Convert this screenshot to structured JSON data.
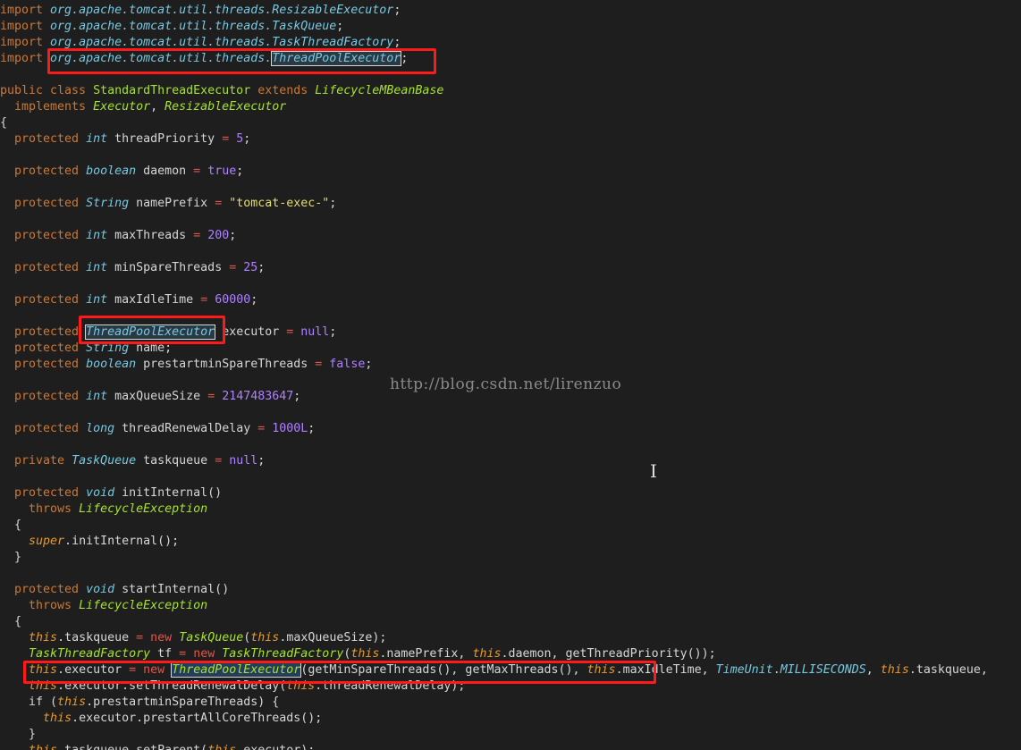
{
  "code": {
    "lines": [
      {
        "tokens": [
          {
            "t": "import ",
            "c": "kw"
          },
          {
            "t": "org.apache.tomcat.util.threads.ResizableExecutor",
            "c": "pk"
          },
          {
            "t": ";"
          }
        ]
      },
      {
        "tokens": [
          {
            "t": "import ",
            "c": "kw"
          },
          {
            "t": "org.apache.tomcat.util.threads.TaskQueue",
            "c": "pk"
          },
          {
            "t": ";"
          }
        ]
      },
      {
        "tokens": [
          {
            "t": "import ",
            "c": "kw"
          },
          {
            "t": "org.apache.tomcat.util.threads.TaskThreadFactory",
            "c": "pk"
          },
          {
            "t": ";"
          }
        ]
      },
      {
        "tokens": [
          {
            "t": "import ",
            "c": "kw"
          },
          {
            "t": "org.apache.tomcat.util.threads.",
            "c": "pk"
          },
          {
            "t": "ThreadPoolExecutor",
            "c": "pk hl"
          },
          {
            "t": ";"
          }
        ]
      },
      {
        "tokens": []
      },
      {
        "tokens": [
          {
            "t": "public class ",
            "c": "kw"
          },
          {
            "t": "StandardThreadExecutor",
            "c": "cls"
          },
          {
            "t": " extends ",
            "c": "kw"
          },
          {
            "t": "LifecycleMBeanBase",
            "c": "sup"
          }
        ]
      },
      {
        "tokens": [
          {
            "t": "  implements ",
            "c": "kw"
          },
          {
            "t": "Executor",
            "c": "sup"
          },
          {
            "t": ", "
          },
          {
            "t": "ResizableExecutor",
            "c": "sup"
          }
        ]
      },
      {
        "tokens": [
          {
            "t": "{"
          }
        ]
      },
      {
        "tokens": [
          {
            "t": "  protected ",
            "c": "kw"
          },
          {
            "t": "int",
            "c": "ty"
          },
          {
            "t": " threadPriority "
          },
          {
            "t": "=",
            "c": "op"
          },
          {
            "t": " "
          },
          {
            "t": "5",
            "c": "num"
          },
          {
            "t": ";"
          }
        ]
      },
      {
        "tokens": []
      },
      {
        "tokens": [
          {
            "t": "  protected ",
            "c": "kw"
          },
          {
            "t": "boolean",
            "c": "ty"
          },
          {
            "t": " daemon "
          },
          {
            "t": "=",
            "c": "op"
          },
          {
            "t": " "
          },
          {
            "t": "true",
            "c": "num"
          },
          {
            "t": ";"
          }
        ]
      },
      {
        "tokens": []
      },
      {
        "tokens": [
          {
            "t": "  protected ",
            "c": "kw"
          },
          {
            "t": "String",
            "c": "ty"
          },
          {
            "t": " namePrefix "
          },
          {
            "t": "=",
            "c": "op"
          },
          {
            "t": " "
          },
          {
            "t": "\"tomcat-exec-\"",
            "c": "str"
          },
          {
            "t": ";"
          }
        ]
      },
      {
        "tokens": []
      },
      {
        "tokens": [
          {
            "t": "  protected ",
            "c": "kw"
          },
          {
            "t": "int",
            "c": "ty"
          },
          {
            "t": " maxThreads "
          },
          {
            "t": "=",
            "c": "op"
          },
          {
            "t": " "
          },
          {
            "t": "200",
            "c": "num"
          },
          {
            "t": ";"
          }
        ]
      },
      {
        "tokens": []
      },
      {
        "tokens": [
          {
            "t": "  protected ",
            "c": "kw"
          },
          {
            "t": "int",
            "c": "ty"
          },
          {
            "t": " minSpareThreads "
          },
          {
            "t": "=",
            "c": "op"
          },
          {
            "t": " "
          },
          {
            "t": "25",
            "c": "num"
          },
          {
            "t": ";"
          }
        ]
      },
      {
        "tokens": []
      },
      {
        "tokens": [
          {
            "t": "  protected ",
            "c": "kw"
          },
          {
            "t": "int",
            "c": "ty"
          },
          {
            "t": " maxIdleTime "
          },
          {
            "t": "=",
            "c": "op"
          },
          {
            "t": " "
          },
          {
            "t": "60000",
            "c": "num"
          },
          {
            "t": ";"
          }
        ]
      },
      {
        "tokens": []
      },
      {
        "tokens": [
          {
            "t": "  protected ",
            "c": "kw"
          },
          {
            "t": "ThreadPoolExecutor",
            "c": "ty hl"
          },
          {
            "t": " executor "
          },
          {
            "t": "=",
            "c": "op"
          },
          {
            "t": " "
          },
          {
            "t": "null",
            "c": "num"
          },
          {
            "t": ";"
          }
        ]
      },
      {
        "tokens": [
          {
            "t": "  protected ",
            "c": "kw"
          },
          {
            "t": "String",
            "c": "ty"
          },
          {
            "t": " name;"
          }
        ]
      },
      {
        "tokens": [
          {
            "t": "  protected ",
            "c": "kw"
          },
          {
            "t": "boolean",
            "c": "ty"
          },
          {
            "t": " prestartminSpareThreads "
          },
          {
            "t": "=",
            "c": "op"
          },
          {
            "t": " "
          },
          {
            "t": "false",
            "c": "num"
          },
          {
            "t": ";"
          }
        ]
      },
      {
        "tokens": []
      },
      {
        "tokens": [
          {
            "t": "  protected ",
            "c": "kw"
          },
          {
            "t": "int",
            "c": "ty"
          },
          {
            "t": " maxQueueSize "
          },
          {
            "t": "=",
            "c": "op"
          },
          {
            "t": " "
          },
          {
            "t": "2147483647",
            "c": "num"
          },
          {
            "t": ";"
          }
        ]
      },
      {
        "tokens": []
      },
      {
        "tokens": [
          {
            "t": "  protected ",
            "c": "kw"
          },
          {
            "t": "long",
            "c": "ty"
          },
          {
            "t": " threadRenewalDelay "
          },
          {
            "t": "=",
            "c": "op"
          },
          {
            "t": " "
          },
          {
            "t": "1000L",
            "c": "num"
          },
          {
            "t": ";"
          }
        ]
      },
      {
        "tokens": []
      },
      {
        "tokens": [
          {
            "t": "  private ",
            "c": "kw"
          },
          {
            "t": "TaskQueue",
            "c": "ty"
          },
          {
            "t": " taskqueue "
          },
          {
            "t": "=",
            "c": "op"
          },
          {
            "t": " "
          },
          {
            "t": "null",
            "c": "num"
          },
          {
            "t": ";"
          }
        ]
      },
      {
        "tokens": []
      },
      {
        "tokens": [
          {
            "t": "  protected ",
            "c": "kw"
          },
          {
            "t": "void",
            "c": "ty"
          },
          {
            "t": " initInternal()"
          }
        ]
      },
      {
        "tokens": [
          {
            "t": "    throws ",
            "c": "kw"
          },
          {
            "t": "LifecycleException",
            "c": "sup"
          }
        ]
      },
      {
        "tokens": [
          {
            "t": "  {"
          }
        ]
      },
      {
        "tokens": [
          {
            "t": "    "
          },
          {
            "t": "super",
            "c": "ths"
          },
          {
            "t": ".initInternal();"
          }
        ]
      },
      {
        "tokens": [
          {
            "t": "  }"
          }
        ]
      },
      {
        "tokens": []
      },
      {
        "tokens": [
          {
            "t": "  protected ",
            "c": "kw"
          },
          {
            "t": "void",
            "c": "ty"
          },
          {
            "t": " startInternal()"
          }
        ]
      },
      {
        "tokens": [
          {
            "t": "    throws ",
            "c": "kw"
          },
          {
            "t": "LifecycleException",
            "c": "sup"
          }
        ]
      },
      {
        "tokens": [
          {
            "t": "  {"
          }
        ]
      },
      {
        "tokens": [
          {
            "t": "    "
          },
          {
            "t": "this",
            "c": "ths"
          },
          {
            "t": ".taskqueue "
          },
          {
            "t": "=",
            "c": "op"
          },
          {
            "t": " "
          },
          {
            "t": "new",
            "c": "op"
          },
          {
            "t": " "
          },
          {
            "t": "TaskQueue",
            "c": "sup"
          },
          {
            "t": "("
          },
          {
            "t": "this",
            "c": "ths"
          },
          {
            "t": ".maxQueueSize);"
          }
        ]
      },
      {
        "tokens": [
          {
            "t": "    "
          },
          {
            "t": "TaskThreadFactory",
            "c": "sup"
          },
          {
            "t": " tf "
          },
          {
            "t": "=",
            "c": "op"
          },
          {
            "t": " "
          },
          {
            "t": "new",
            "c": "op"
          },
          {
            "t": " "
          },
          {
            "t": "TaskThreadFactory",
            "c": "sup"
          },
          {
            "t": "("
          },
          {
            "t": "this",
            "c": "ths"
          },
          {
            "t": ".namePrefix, "
          },
          {
            "t": "this",
            "c": "ths"
          },
          {
            "t": ".daemon, getThreadPriority());"
          }
        ]
      },
      {
        "tokens": [
          {
            "t": "    "
          },
          {
            "t": "this",
            "c": "ths"
          },
          {
            "t": ".executor "
          },
          {
            "t": "=",
            "c": "op"
          },
          {
            "t": " "
          },
          {
            "t": "new",
            "c": "op"
          },
          {
            "t": " "
          },
          {
            "t": "ThreadPoolExecutor",
            "c": "sup hl2"
          },
          {
            "t": "(getMinSpareThreads(), getMaxThreads(), "
          },
          {
            "t": "this",
            "c": "ths"
          },
          {
            "t": ".maxIdleTime, "
          },
          {
            "t": "TimeUnit",
            "c": "ty"
          },
          {
            "t": "."
          },
          {
            "t": "MILLISECONDS",
            "c": "ty"
          },
          {
            "t": ", "
          },
          {
            "t": "this",
            "c": "ths"
          },
          {
            "t": ".taskqueue,"
          }
        ]
      },
      {
        "tokens": [
          {
            "t": "    "
          },
          {
            "t": "this",
            "c": "ths"
          },
          {
            "t": ".executor.setThreadRenewalDelay("
          },
          {
            "t": "this",
            "c": "ths"
          },
          {
            "t": ".threadRenewalDelay);"
          }
        ]
      },
      {
        "tokens": [
          {
            "t": "    if ("
          },
          {
            "t": "this",
            "c": "ths"
          },
          {
            "t": ".prestartminSpareThreads) {"
          }
        ]
      },
      {
        "tokens": [
          {
            "t": "      "
          },
          {
            "t": "this",
            "c": "ths"
          },
          {
            "t": ".executor.prestartAllCoreThreads();"
          }
        ]
      },
      {
        "tokens": [
          {
            "t": "    }"
          }
        ]
      },
      {
        "tokens": [
          {
            "t": "    "
          },
          {
            "t": "this",
            "c": "ths"
          },
          {
            "t": ".taskqueue.setParent("
          },
          {
            "t": "this",
            "c": "ths"
          },
          {
            "t": ".executor);"
          }
        ]
      }
    ]
  },
  "watermark": "http://blog.csdn.net/lirenzuo",
  "cursor_glyph": "I",
  "colors": {
    "background": "#1e1e1e",
    "keyword": "#cc7832",
    "type": "#78c8e0",
    "class": "#a6e22e",
    "number": "#ae81ff",
    "string": "#e6db74",
    "this": "#e69a2e",
    "operator": "#e2554a",
    "annotation_box": "#ff1a1a"
  }
}
